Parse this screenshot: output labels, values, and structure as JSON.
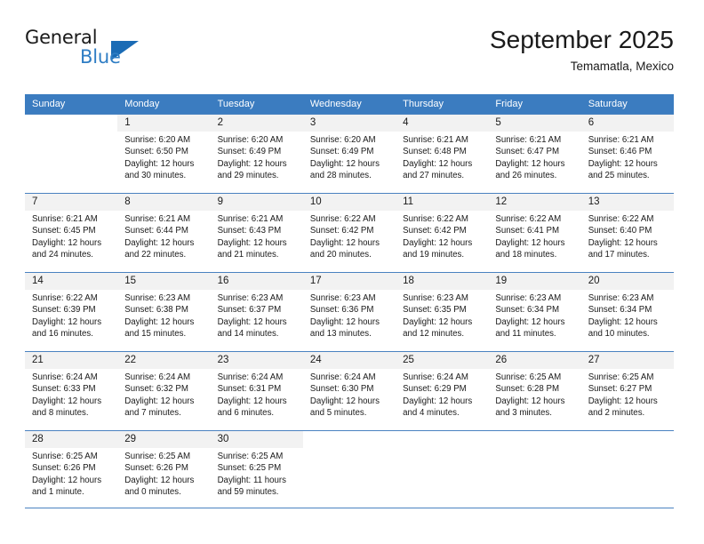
{
  "brand": {
    "name_part1": "General",
    "name_part2": "Blue",
    "triangle_color": "#1a6bb5",
    "blue_color": "#2e7dc4"
  },
  "header": {
    "title": "September 2025",
    "subtitle": "Temamatla, Mexico",
    "header_bg": "#3b7cc0",
    "daynum_bg": "#f2f2f2"
  },
  "weekdays": [
    "Sunday",
    "Monday",
    "Tuesday",
    "Wednesday",
    "Thursday",
    "Friday",
    "Saturday"
  ],
  "labels": {
    "sunrise": "Sunrise:",
    "sunset": "Sunset:",
    "daylight": "Daylight:"
  },
  "weeks": [
    [
      {
        "day": "",
        "sunrise": "",
        "sunset": "",
        "daylight1": "",
        "daylight2": "",
        "empty": true
      },
      {
        "day": "1",
        "sunrise": "Sunrise: 6:20 AM",
        "sunset": "Sunset: 6:50 PM",
        "daylight1": "Daylight: 12 hours",
        "daylight2": "and 30 minutes.",
        "empty": false
      },
      {
        "day": "2",
        "sunrise": "Sunrise: 6:20 AM",
        "sunset": "Sunset: 6:49 PM",
        "daylight1": "Daylight: 12 hours",
        "daylight2": "and 29 minutes.",
        "empty": false
      },
      {
        "day": "3",
        "sunrise": "Sunrise: 6:20 AM",
        "sunset": "Sunset: 6:49 PM",
        "daylight1": "Daylight: 12 hours",
        "daylight2": "and 28 minutes.",
        "empty": false
      },
      {
        "day": "4",
        "sunrise": "Sunrise: 6:21 AM",
        "sunset": "Sunset: 6:48 PM",
        "daylight1": "Daylight: 12 hours",
        "daylight2": "and 27 minutes.",
        "empty": false
      },
      {
        "day": "5",
        "sunrise": "Sunrise: 6:21 AM",
        "sunset": "Sunset: 6:47 PM",
        "daylight1": "Daylight: 12 hours",
        "daylight2": "and 26 minutes.",
        "empty": false
      },
      {
        "day": "6",
        "sunrise": "Sunrise: 6:21 AM",
        "sunset": "Sunset: 6:46 PM",
        "daylight1": "Daylight: 12 hours",
        "daylight2": "and 25 minutes.",
        "empty": false
      }
    ],
    [
      {
        "day": "7",
        "sunrise": "Sunrise: 6:21 AM",
        "sunset": "Sunset: 6:45 PM",
        "daylight1": "Daylight: 12 hours",
        "daylight2": "and 24 minutes.",
        "empty": false
      },
      {
        "day": "8",
        "sunrise": "Sunrise: 6:21 AM",
        "sunset": "Sunset: 6:44 PM",
        "daylight1": "Daylight: 12 hours",
        "daylight2": "and 22 minutes.",
        "empty": false
      },
      {
        "day": "9",
        "sunrise": "Sunrise: 6:21 AM",
        "sunset": "Sunset: 6:43 PM",
        "daylight1": "Daylight: 12 hours",
        "daylight2": "and 21 minutes.",
        "empty": false
      },
      {
        "day": "10",
        "sunrise": "Sunrise: 6:22 AM",
        "sunset": "Sunset: 6:42 PM",
        "daylight1": "Daylight: 12 hours",
        "daylight2": "and 20 minutes.",
        "empty": false
      },
      {
        "day": "11",
        "sunrise": "Sunrise: 6:22 AM",
        "sunset": "Sunset: 6:42 PM",
        "daylight1": "Daylight: 12 hours",
        "daylight2": "and 19 minutes.",
        "empty": false
      },
      {
        "day": "12",
        "sunrise": "Sunrise: 6:22 AM",
        "sunset": "Sunset: 6:41 PM",
        "daylight1": "Daylight: 12 hours",
        "daylight2": "and 18 minutes.",
        "empty": false
      },
      {
        "day": "13",
        "sunrise": "Sunrise: 6:22 AM",
        "sunset": "Sunset: 6:40 PM",
        "daylight1": "Daylight: 12 hours",
        "daylight2": "and 17 minutes.",
        "empty": false
      }
    ],
    [
      {
        "day": "14",
        "sunrise": "Sunrise: 6:22 AM",
        "sunset": "Sunset: 6:39 PM",
        "daylight1": "Daylight: 12 hours",
        "daylight2": "and 16 minutes.",
        "empty": false
      },
      {
        "day": "15",
        "sunrise": "Sunrise: 6:23 AM",
        "sunset": "Sunset: 6:38 PM",
        "daylight1": "Daylight: 12 hours",
        "daylight2": "and 15 minutes.",
        "empty": false
      },
      {
        "day": "16",
        "sunrise": "Sunrise: 6:23 AM",
        "sunset": "Sunset: 6:37 PM",
        "daylight1": "Daylight: 12 hours",
        "daylight2": "and 14 minutes.",
        "empty": false
      },
      {
        "day": "17",
        "sunrise": "Sunrise: 6:23 AM",
        "sunset": "Sunset: 6:36 PM",
        "daylight1": "Daylight: 12 hours",
        "daylight2": "and 13 minutes.",
        "empty": false
      },
      {
        "day": "18",
        "sunrise": "Sunrise: 6:23 AM",
        "sunset": "Sunset: 6:35 PM",
        "daylight1": "Daylight: 12 hours",
        "daylight2": "and 12 minutes.",
        "empty": false
      },
      {
        "day": "19",
        "sunrise": "Sunrise: 6:23 AM",
        "sunset": "Sunset: 6:34 PM",
        "daylight1": "Daylight: 12 hours",
        "daylight2": "and 11 minutes.",
        "empty": false
      },
      {
        "day": "20",
        "sunrise": "Sunrise: 6:23 AM",
        "sunset": "Sunset: 6:34 PM",
        "daylight1": "Daylight: 12 hours",
        "daylight2": "and 10 minutes.",
        "empty": false
      }
    ],
    [
      {
        "day": "21",
        "sunrise": "Sunrise: 6:24 AM",
        "sunset": "Sunset: 6:33 PM",
        "daylight1": "Daylight: 12 hours",
        "daylight2": "and 8 minutes.",
        "empty": false
      },
      {
        "day": "22",
        "sunrise": "Sunrise: 6:24 AM",
        "sunset": "Sunset: 6:32 PM",
        "daylight1": "Daylight: 12 hours",
        "daylight2": "and 7 minutes.",
        "empty": false
      },
      {
        "day": "23",
        "sunrise": "Sunrise: 6:24 AM",
        "sunset": "Sunset: 6:31 PM",
        "daylight1": "Daylight: 12 hours",
        "daylight2": "and 6 minutes.",
        "empty": false
      },
      {
        "day": "24",
        "sunrise": "Sunrise: 6:24 AM",
        "sunset": "Sunset: 6:30 PM",
        "daylight1": "Daylight: 12 hours",
        "daylight2": "and 5 minutes.",
        "empty": false
      },
      {
        "day": "25",
        "sunrise": "Sunrise: 6:24 AM",
        "sunset": "Sunset: 6:29 PM",
        "daylight1": "Daylight: 12 hours",
        "daylight2": "and 4 minutes.",
        "empty": false
      },
      {
        "day": "26",
        "sunrise": "Sunrise: 6:25 AM",
        "sunset": "Sunset: 6:28 PM",
        "daylight1": "Daylight: 12 hours",
        "daylight2": "and 3 minutes.",
        "empty": false
      },
      {
        "day": "27",
        "sunrise": "Sunrise: 6:25 AM",
        "sunset": "Sunset: 6:27 PM",
        "daylight1": "Daylight: 12 hours",
        "daylight2": "and 2 minutes.",
        "empty": false
      }
    ],
    [
      {
        "day": "28",
        "sunrise": "Sunrise: 6:25 AM",
        "sunset": "Sunset: 6:26 PM",
        "daylight1": "Daylight: 12 hours",
        "daylight2": "and 1 minute.",
        "empty": false
      },
      {
        "day": "29",
        "sunrise": "Sunrise: 6:25 AM",
        "sunset": "Sunset: 6:26 PM",
        "daylight1": "Daylight: 12 hours",
        "daylight2": "and 0 minutes.",
        "empty": false
      },
      {
        "day": "30",
        "sunrise": "Sunrise: 6:25 AM",
        "sunset": "Sunset: 6:25 PM",
        "daylight1": "Daylight: 11 hours",
        "daylight2": "and 59 minutes.",
        "empty": false
      },
      {
        "day": "",
        "sunrise": "",
        "sunset": "",
        "daylight1": "",
        "daylight2": "",
        "empty": true
      },
      {
        "day": "",
        "sunrise": "",
        "sunset": "",
        "daylight1": "",
        "daylight2": "",
        "empty": true
      },
      {
        "day": "",
        "sunrise": "",
        "sunset": "",
        "daylight1": "",
        "daylight2": "",
        "empty": true
      },
      {
        "day": "",
        "sunrise": "",
        "sunset": "",
        "daylight1": "",
        "daylight2": "",
        "empty": true
      }
    ]
  ]
}
